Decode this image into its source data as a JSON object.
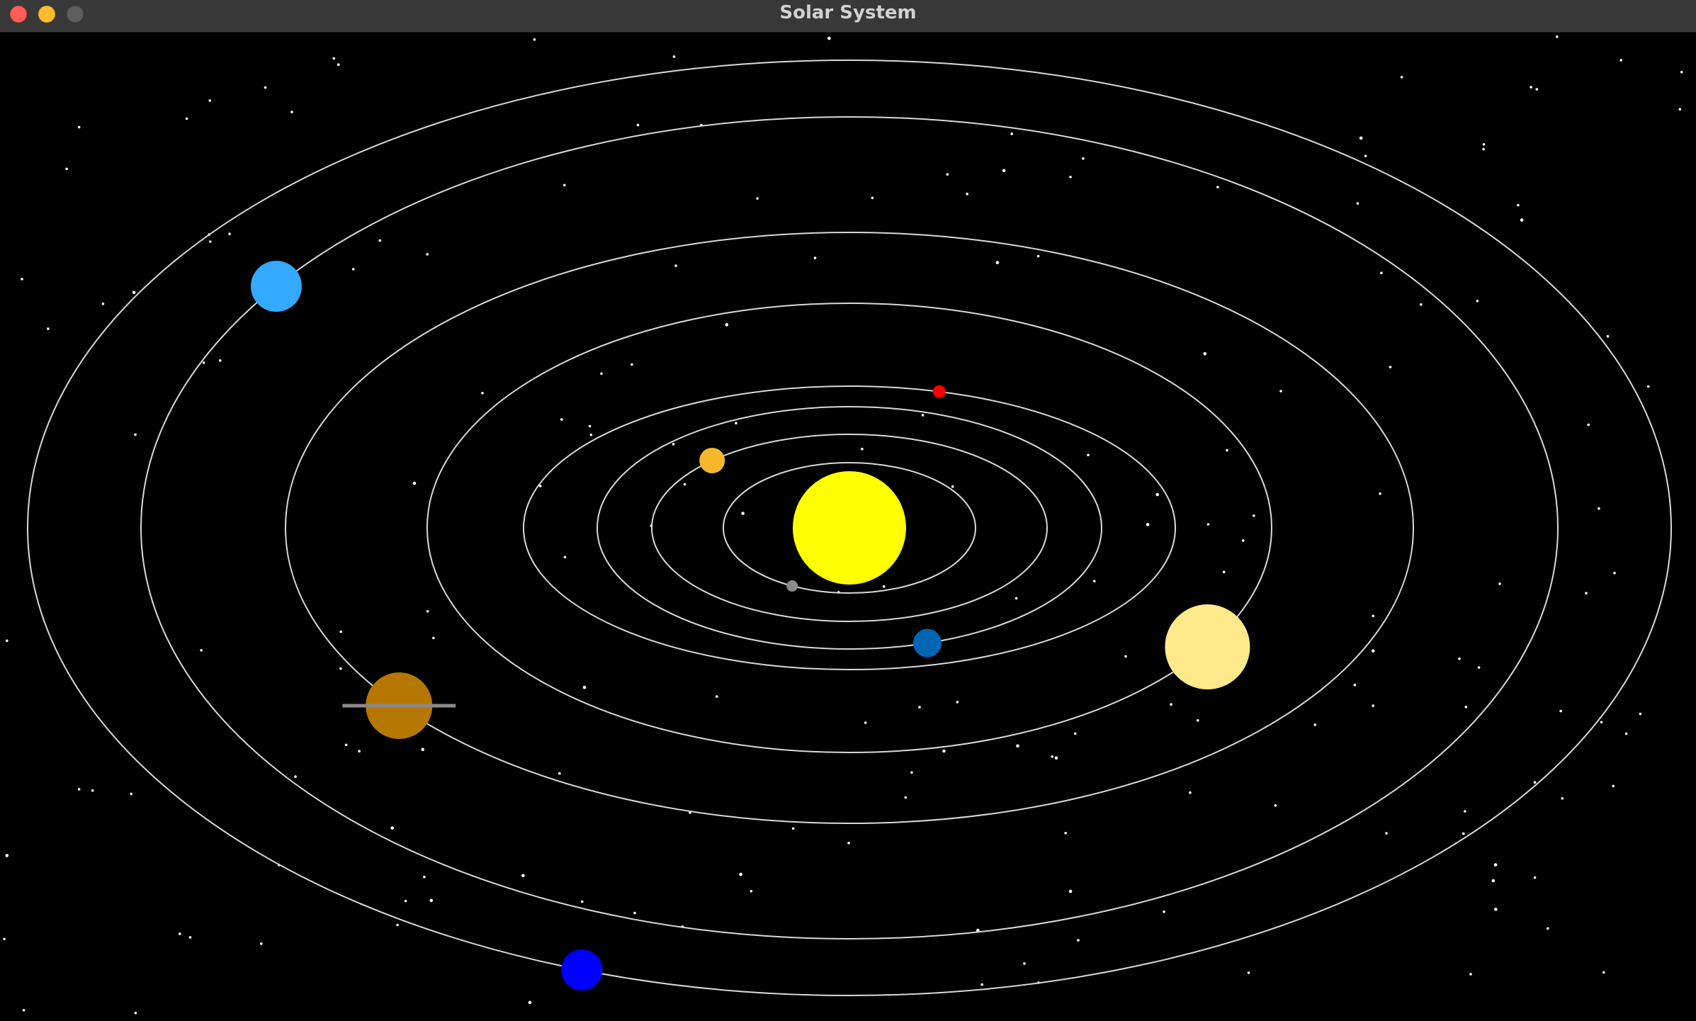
{
  "window": {
    "title": "Solar System"
  },
  "controls": [
    {
      "name": "close",
      "color": "#ff5f57"
    },
    {
      "name": "minimize",
      "color": "#febc2e"
    },
    {
      "name": "zoom",
      "color": "#5e5e5e"
    }
  ],
  "colors": {
    "background": "#000000",
    "orbit": "#d9d9d9",
    "star": "#ffffff",
    "ring": "#8a8a8a"
  },
  "sun": {
    "name": "sun",
    "color": "#ffff00"
  },
  "planets": [
    {
      "name": "mercury",
      "color": "#8c8c8c",
      "orbit": 1,
      "angle": 117
    },
    {
      "name": "venus",
      "color": "#f7b72a",
      "orbit": 2,
      "angle": 226
    },
    {
      "name": "earth",
      "color": "#0066b3",
      "orbit": 3,
      "angle": 72
    },
    {
      "name": "mars",
      "color": "#ff0000",
      "orbit": 4,
      "angle": 286
    },
    {
      "name": "jupiter",
      "color": "#ffe98a",
      "orbit": 5,
      "angle": 32
    },
    {
      "name": "saturn",
      "color": "#b67700",
      "orbit": 6,
      "angle": 143,
      "ring": true
    },
    {
      "name": "uranus",
      "color": "#33aaff",
      "orbit": 7,
      "angle": 216
    },
    {
      "name": "neptune",
      "color": "#0000ff",
      "orbit": 8,
      "angle": 109
    }
  ]
}
